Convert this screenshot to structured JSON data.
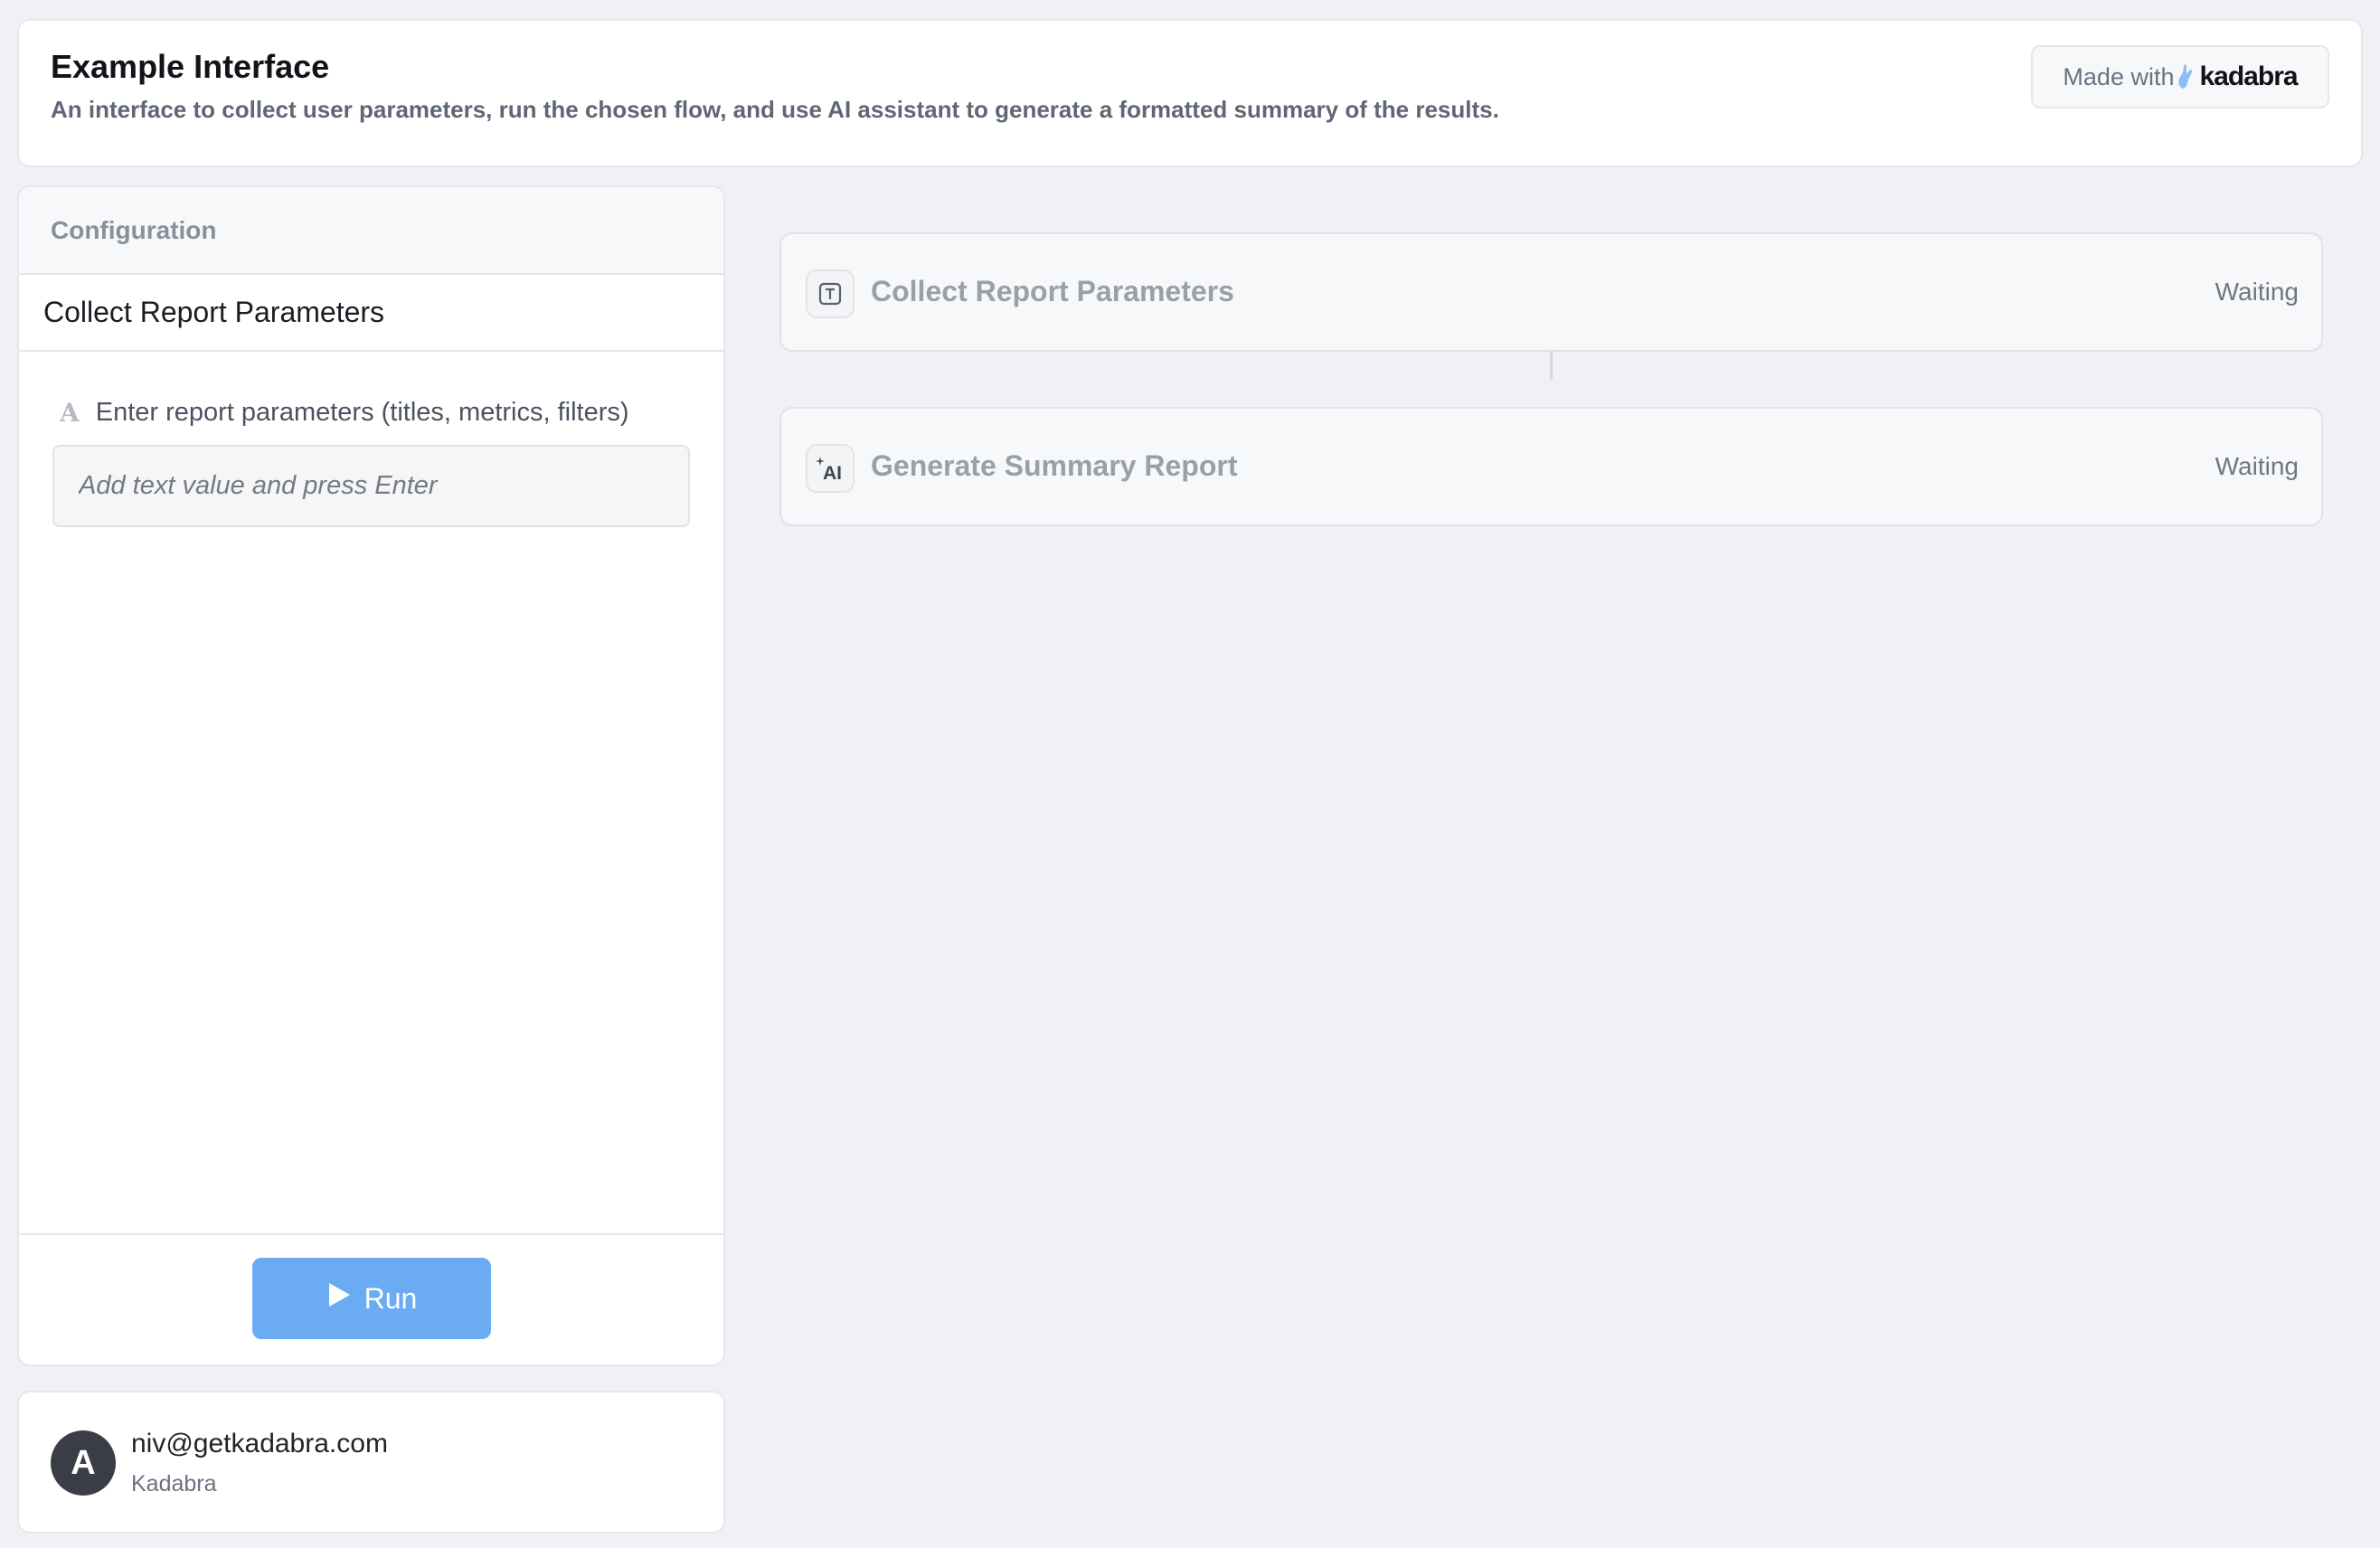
{
  "header": {
    "title": "Example Interface",
    "subtitle": "An interface to collect user parameters, run the chosen flow, and use AI assistant to generate a formatted summary of the results.",
    "made_with": "Made with",
    "brand": "kadabra"
  },
  "config": {
    "heading": "Configuration",
    "step_title": "Collect Report Parameters",
    "field_label": "Enter report parameters (titles, metrics, filters)",
    "field_placeholder": "Add text value and press Enter",
    "field_value": "",
    "run_label": "Run"
  },
  "user": {
    "avatar_initial": "A",
    "email": "niv@getkadabra.com",
    "org": "Kadabra"
  },
  "flow": {
    "steps": [
      {
        "name": "Collect Report Parameters",
        "status": "Waiting",
        "icon": "text-icon"
      },
      {
        "name": "Generate Summary Report",
        "status": "Waiting",
        "icon": "ai-sparkle-icon"
      }
    ]
  },
  "colors": {
    "accent": "#6aabf4",
    "background": "#eff1f5"
  }
}
